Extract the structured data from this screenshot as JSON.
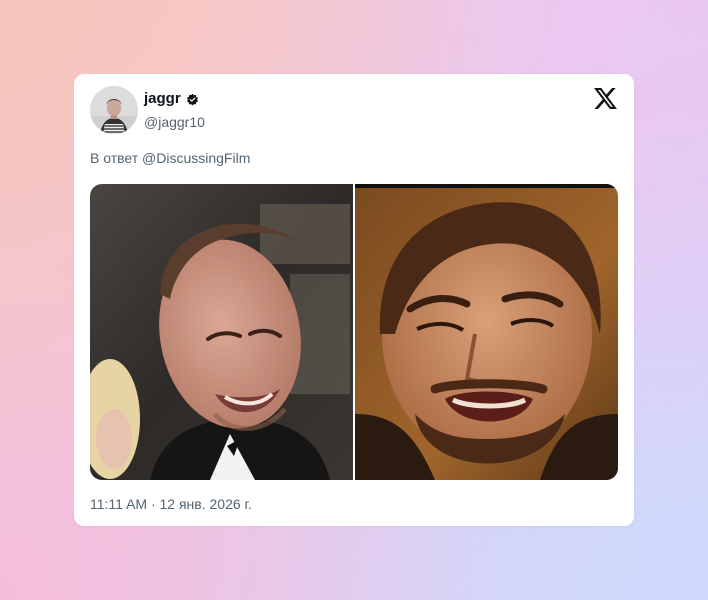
{
  "tweet": {
    "author_name": "jaggr",
    "author_handle": "@jaggr10",
    "reply_to": "В ответ @DiscussingFilm",
    "timestamp": "11:11 AM · 12 янв. 2026 г.",
    "icons": {
      "verified": "verified-badge-icon",
      "platform": "x-logo-icon"
    },
    "media": [
      {
        "description_icon": "laughing-man-photo"
      },
      {
        "description_icon": "laughing-man-photo"
      }
    ]
  },
  "colors": {
    "text_primary": "#0f1419",
    "text_secondary": "#536471",
    "card_background": "#ffffff"
  }
}
